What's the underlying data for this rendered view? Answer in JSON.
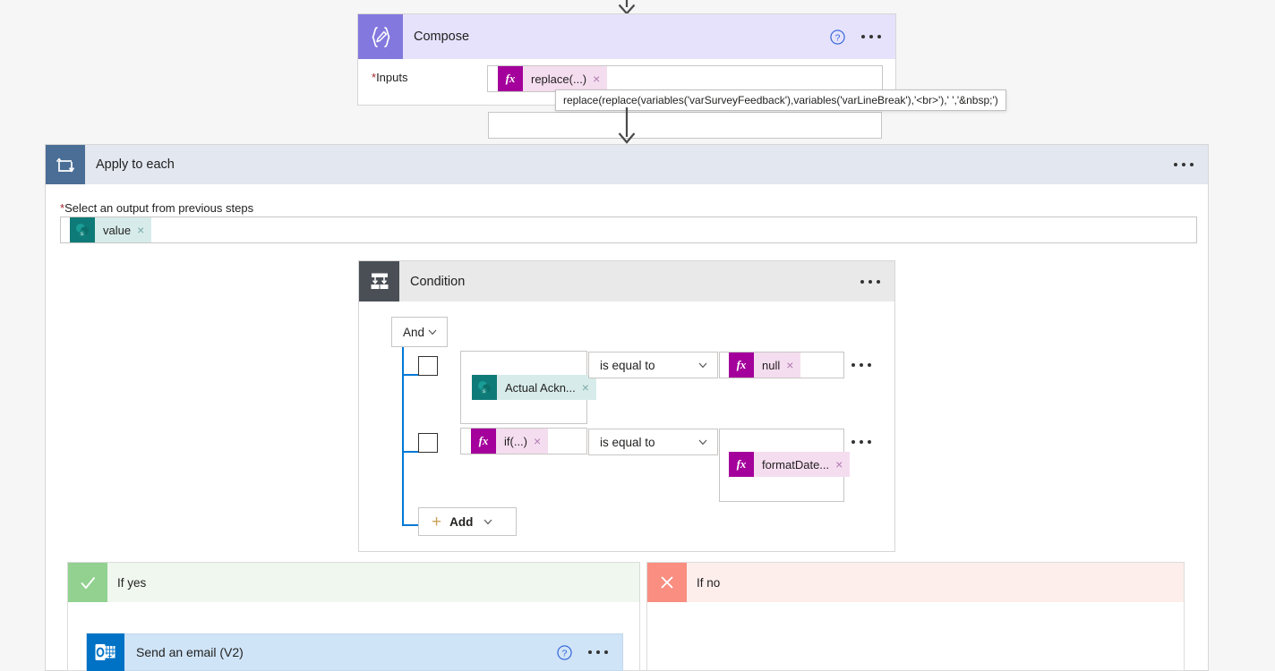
{
  "flow": {
    "compose": {
      "title": "Compose",
      "icon": "compose-braces-pencil-icon",
      "help_icon": "help-icon",
      "more_icon": "more-options-icon",
      "inputs_label": "Inputs",
      "required_marker": "*",
      "input_token": {
        "label": "replace(...)",
        "icon": "fx-icon",
        "remove": "×"
      },
      "tooltip": "replace(replace(variables('varSurveyFeedback'),variables('varLineBreak'),'<br>'),' ','&nbsp;')"
    },
    "apply_to_each": {
      "title": "Apply to each",
      "icon": "loop-icon",
      "more_icon": "more-options-icon",
      "select_label": "Select an output from previous steps",
      "required_marker": "*",
      "value_token": {
        "label": "value",
        "icon": "sharepoint-icon",
        "remove": "×"
      }
    },
    "condition": {
      "title": "Condition",
      "icon": "condition-branch-icon",
      "more_icon": "more-options-icon",
      "logic_operator": "And",
      "rows": [
        {
          "left_token": {
            "label": "Actual Ackn...",
            "icon": "sharepoint-icon",
            "remove": "×",
            "kind": "sp"
          },
          "operator": "is equal to",
          "right_token": {
            "label": "null",
            "icon": "fx-icon",
            "remove": "×",
            "kind": "fx"
          },
          "checkbox_checked": false,
          "row_more_icon": "more-options-icon"
        },
        {
          "left_token": {
            "label": "if(...)",
            "icon": "fx-icon",
            "remove": "×",
            "kind": "fx"
          },
          "operator": "is equal to",
          "right_token": {
            "label": "formatDate...",
            "icon": "fx-icon",
            "remove": "×",
            "kind": "fx"
          },
          "checkbox_checked": false,
          "row_more_icon": "more-options-icon"
        }
      ],
      "add_button": {
        "label": "Add",
        "plus": "+",
        "chevron": "chevron-down-icon"
      }
    },
    "branches": {
      "if_yes": {
        "title": "If yes",
        "icon": "checkmark-icon",
        "action": {
          "title": "Send an email (V2)",
          "icon": "outlook-icon",
          "help_icon": "help-icon",
          "more_icon": "more-options-icon"
        }
      },
      "if_no": {
        "title": "If no",
        "icon": "close-x-icon"
      }
    }
  },
  "colors": {
    "compose_accent": "#8378de",
    "apply_accent": "#4a6e96",
    "condition_accent": "#4a4f56",
    "sharepoint": "#0f7b78",
    "fx_magenta": "#a4009b",
    "yes_green": "#92d18f",
    "no_red": "#f98e81",
    "connector_blue": "#0078d4",
    "outlook_blue": "#0072c6"
  }
}
